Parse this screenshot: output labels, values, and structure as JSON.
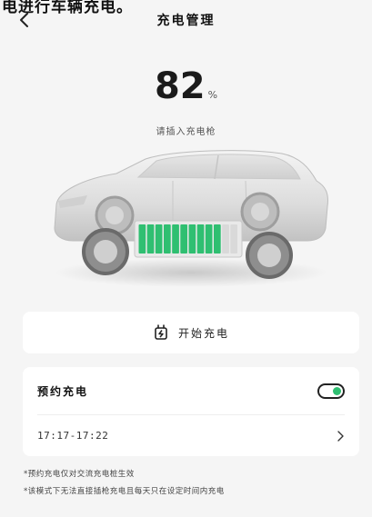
{
  "top_partial_text": "电进行车辆充电。",
  "header": {
    "title": "充电管理"
  },
  "battery": {
    "percent": "82",
    "unit": "%",
    "level": 0.82
  },
  "status": {
    "text": "请插入充电枪"
  },
  "charge_button": {
    "label": "开始充电",
    "icon": "charger-plug-icon"
  },
  "schedule": {
    "title": "预约充电",
    "enabled": true,
    "time_range": "17:17-17:22"
  },
  "notes": [
    "*预约充电仅对交流充电桩生效",
    "*该模式下无法直接插枪充电且每天只在设定时间内充电"
  ],
  "colors": {
    "accent": "#2fbf71",
    "background": "#f5f5f5",
    "card": "#ffffff"
  }
}
